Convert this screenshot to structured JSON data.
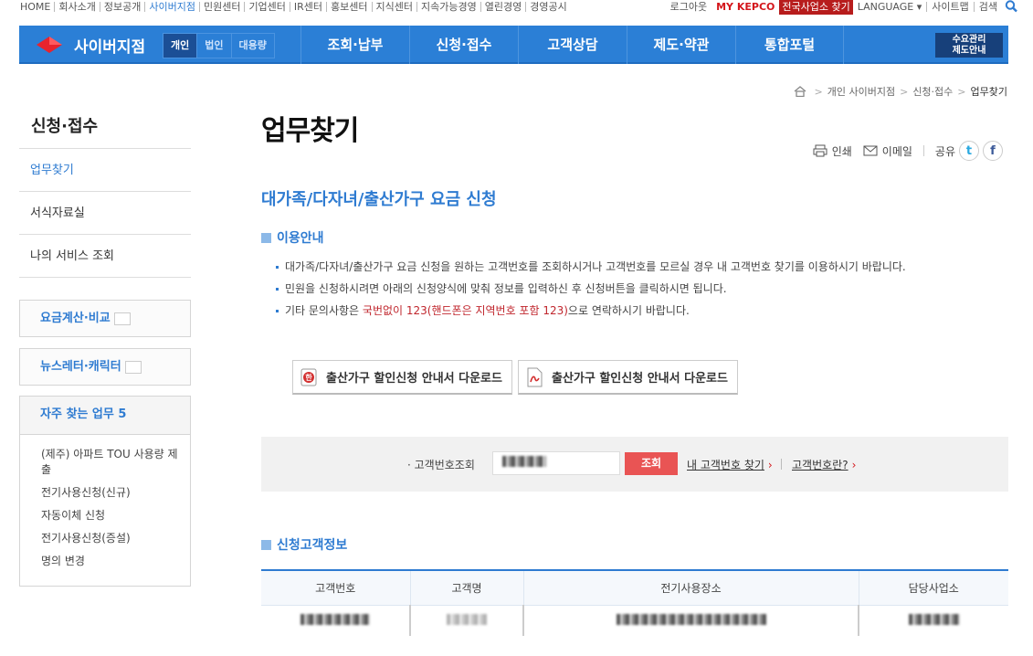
{
  "util": {
    "left_links": [
      "HOME",
      "회사소개",
      "정보공개",
      "사이버지점",
      "민원센터",
      "기업센터",
      "IR센터",
      "홍보센터",
      "지식센터",
      "지속가능경영",
      "열린경영",
      "경영공시"
    ],
    "logout": "로그아웃",
    "my_kepco": "MY KEPCO",
    "office_find": "전국사업소 찾기",
    "language": "LANGUAGE",
    "sitemap": "사이트맵",
    "search": "검색"
  },
  "gnb": {
    "brand": "사이버지점",
    "segments": [
      "개인",
      "법인",
      "대용량"
    ],
    "menu": [
      "조회·납부",
      "신청·접수",
      "고객상담",
      "제도·약관",
      "통합포털"
    ],
    "demand_line1": "수요관리",
    "demand_line2": "제도안내"
  },
  "breadcrumb": [
    "개인 사이버지점",
    "신청·접수",
    "업무찾기"
  ],
  "sidebar": {
    "title": "신청·접수",
    "items": [
      "업무찾기",
      "서식자료실",
      "나의 서비스 조회"
    ],
    "box1": "요금계산·비교",
    "box2": "뉴스레터·캐릭터",
    "freq_title": "자주 찾는 업무 5",
    "freq_items": [
      "(제주) 아파트 TOU 사용량 제출",
      "전기사용신청(신규)",
      "자동이체 신청",
      "전기사용신청(증설)",
      "명의 변경"
    ]
  },
  "main": {
    "title": "업무찾기",
    "tools": {
      "print": "인쇄",
      "email": "이메일",
      "share": "공유"
    },
    "subtitle": "대가족/다자녀/출산가구 요금 신청",
    "guide_title": "이용안내",
    "guide": {
      "line1": "대가족/다자녀/출산가구 요금 신청을 원하는 고객번호를 조회하시거나 고객번호를 모르실 경우 내 고객번호 찾기를 이용하시기 바랍니다.",
      "line2": "민원을 신청하시려면 아래의 신청양식에 맞춰 정보를 입력하신 후 신청버튼을 클릭하시면 됩니다.",
      "line3_pre": "기타 문의사항은 ",
      "line3_red": "국번없이 123(핸드폰은 지역번호 포함 123)",
      "line3_post": "으로 연락하시기 바랍니다."
    },
    "downloads": [
      "출산가구 할인신청 안내서 다운로드",
      "출산가구 할인신청 안내서 다운로드"
    ],
    "lookup": {
      "label": "· 고객번호조회",
      "button": "조회",
      "link_find": "내 고객번호 찾기",
      "link_what": "고객번호란?"
    },
    "cust_title": "신청고객정보",
    "table_headers": [
      "고객번호",
      "고객명",
      "전기사용장소",
      "담당사업소"
    ]
  }
}
